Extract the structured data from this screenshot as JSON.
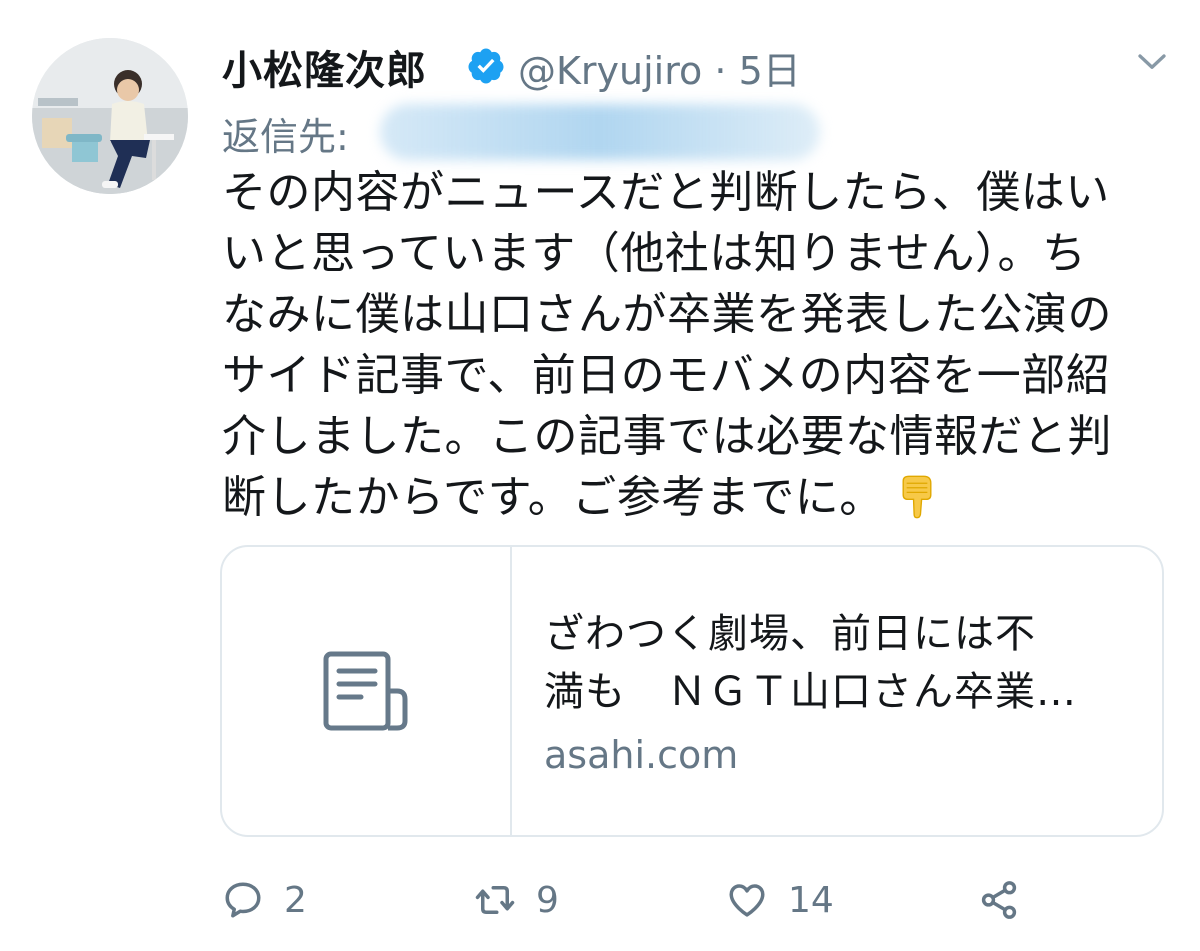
{
  "author": {
    "display_name": "小松隆次郎",
    "verified_icon": "verified-badge-icon",
    "handle": "@Kryujiro",
    "separator": "·",
    "time": "5日"
  },
  "reply": {
    "label": "返信先:"
  },
  "tweet": {
    "lines": [
      "その内容がニュースだと判断したら、僕はい",
      "いと思っています（他社は知りません）。ち",
      "なみに僕は山口さんが卒業を発表した公演の",
      "サイド記事で、前日のモバメの内容を一部紹",
      "介しました。この記事では必要な情報だと判",
      "断したからです。ご参考までに。"
    ],
    "emoji": "backhand-index-pointing-down"
  },
  "card": {
    "title_lines": [
      "ざわつく劇場、前日には不",
      "満も　ＮＧＴ山口さん卒業…"
    ],
    "domain": "asahi.com",
    "thumb_icon": "article-document-icon"
  },
  "actions": {
    "reply_count": "2",
    "retweet_count": "9",
    "like_count": "14"
  },
  "colors": {
    "primary_text": "#14171a",
    "secondary_text": "#657786",
    "verified_blue": "#1da1f2",
    "border": "#e1e8ed"
  }
}
